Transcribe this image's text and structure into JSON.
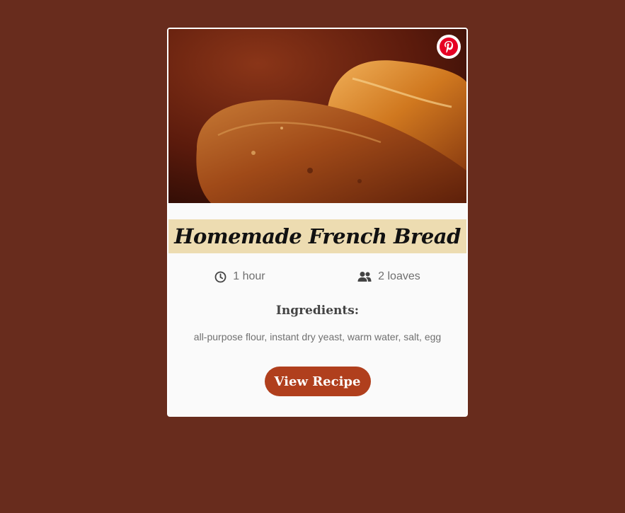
{
  "recipe": {
    "title": "Homemade French Bread",
    "time": "1 hour",
    "servings": "2 loaves",
    "ingredients_heading": "Ingredients:",
    "ingredients": "all-purpose flour, instant dry yeast, warm water, salt, egg",
    "button_label": "View Recipe",
    "image_subject": "french-bread-loaves-photo"
  },
  "icons": {
    "pinterest": "pinterest-icon",
    "time": "clock-icon",
    "servings": "people-icon"
  },
  "colors": {
    "background": "#682c1d",
    "card": "#fafafa",
    "title_band": "#eddcb1",
    "button": "#b03f1d",
    "pinterest": "#e60023"
  }
}
